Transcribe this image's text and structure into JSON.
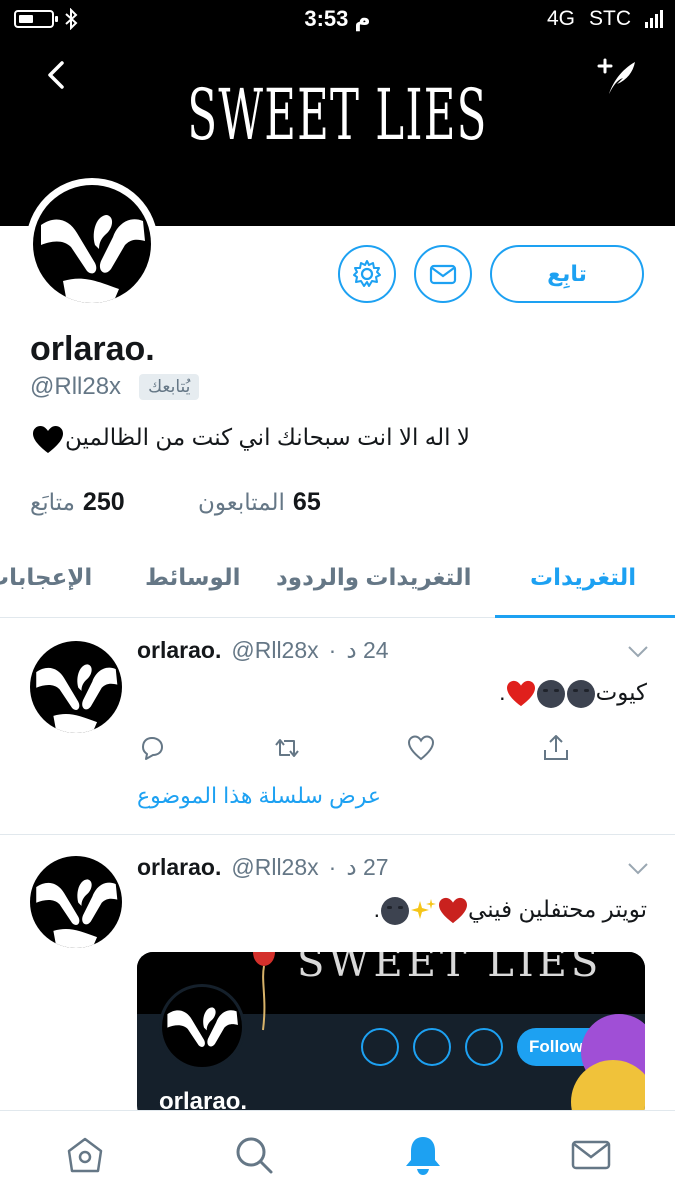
{
  "status_bar": {
    "time": "3:53 م",
    "network": "4G",
    "carrier": "STC"
  },
  "header": {
    "banner_title": "SWEET LIES",
    "back_icon": "chevron-left-icon",
    "compose_icon": "compose-tweet-icon"
  },
  "profile": {
    "display_name": "orlarao.",
    "handle": "@Rll28x",
    "follows_you": "يُتابعك",
    "bio": "لا اله الا انت سبحانك اني كنت من الظالمين",
    "bio_emoji": "black-heart-icon",
    "follow_label": "تابِع",
    "following_count": "250",
    "following_label": "متابَع",
    "followers_count": "65",
    "followers_label": "المتابعون"
  },
  "tabs": [
    {
      "label": "التغريدات",
      "active": true
    },
    {
      "label": "التغريدات والردود",
      "active": false
    },
    {
      "label": "الوسائط",
      "active": false
    },
    {
      "label": "الإعجابات",
      "active": false
    }
  ],
  "tweets": [
    {
      "name": "orlarao.",
      "handle": "@Rll28x",
      "time": "24 د",
      "text": "كيوت",
      "thread_link": "عرض سلسلة هذا الموضوع"
    },
    {
      "name": "orlarao.",
      "handle": "@Rll28x",
      "time": "27 د",
      "text": "تويتر محتفلين فيني",
      "media": {
        "name": "orlarao.",
        "follow_label": "Following"
      }
    }
  ],
  "colors": {
    "accent": "#1da1f2",
    "text_primary": "#14171a",
    "text_secondary": "#657786",
    "divider": "#e1e8ed",
    "banner_bg": "#000000"
  }
}
